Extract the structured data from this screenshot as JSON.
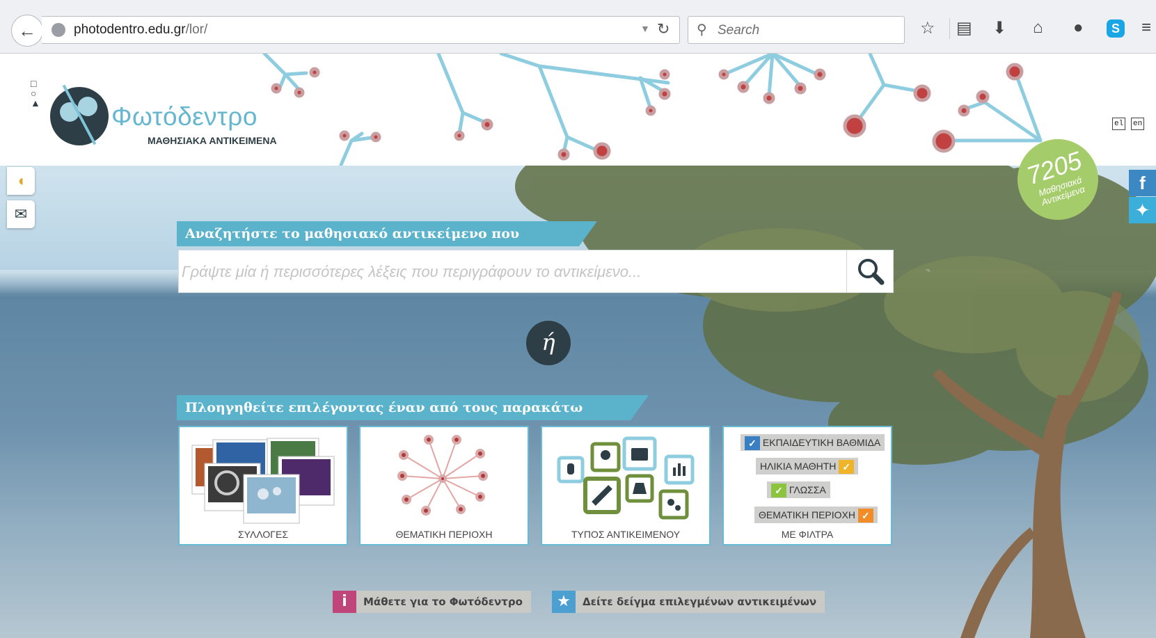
{
  "browser": {
    "url_host": "photodentro.edu.gr",
    "url_path": "/lor/",
    "search_placeholder": "Search"
  },
  "header": {
    "brand_title": "Φωτόδεντρο",
    "brand_subtitle": "ΜΑΘΗΣΙΑΚΑ ΑΝΤΙΚΕΙΜΕΝΑ",
    "languages": [
      "el",
      "en"
    ],
    "count_number": "7205",
    "count_label_1": "Μαθησιακά",
    "count_label_2": "Αντικείμενα"
  },
  "search": {
    "heading": "Αναζητήστε το μαθησιακό αντικείμενο που επιθυμείτε:",
    "placeholder": "Γράψτε μία ή περισσότερες λέξεις που περιγράφουν το αντικείμενο...",
    "or_label": "ή"
  },
  "browse": {
    "heading": "Πλοηγηθείτε επιλέγοντας έναν από τους παρακάτω τρόπους:",
    "cards": [
      {
        "label": "ΣΥΛΛΟΓΕΣ"
      },
      {
        "label": "ΘΕΜΑΤΙΚΗ ΠΕΡΙΟΧΗ"
      },
      {
        "label": "ΤΥΠΟΣ ΑΝΤΙΚΕΙΜΕΝΟΥ"
      },
      {
        "label": "ΜΕ ΦΙΛΤΡΑ"
      }
    ],
    "filter_tags": [
      "ΕΚΠΑΙΔΕΥΤΙΚΗ ΒΑΘΜΙΔΑ",
      "ΗΛΙΚΙΑ ΜΑΘΗΤΗ",
      "ΓΛΩΣΣΑ",
      "ΘΕΜΑΤΙΚΗ ΠΕΡΙΟΧΗ"
    ]
  },
  "footer_links": {
    "about": "Μάθετε για το Φωτόδεντρο",
    "featured": "Δείτε δείγμα επιλεγμένων αντικειμένων"
  },
  "colors": {
    "accent": "#5bb3cb",
    "dark": "#2d3e46",
    "green": "#a5cc6a",
    "orange": "#f28c28",
    "info_pink": "#c0457a"
  }
}
